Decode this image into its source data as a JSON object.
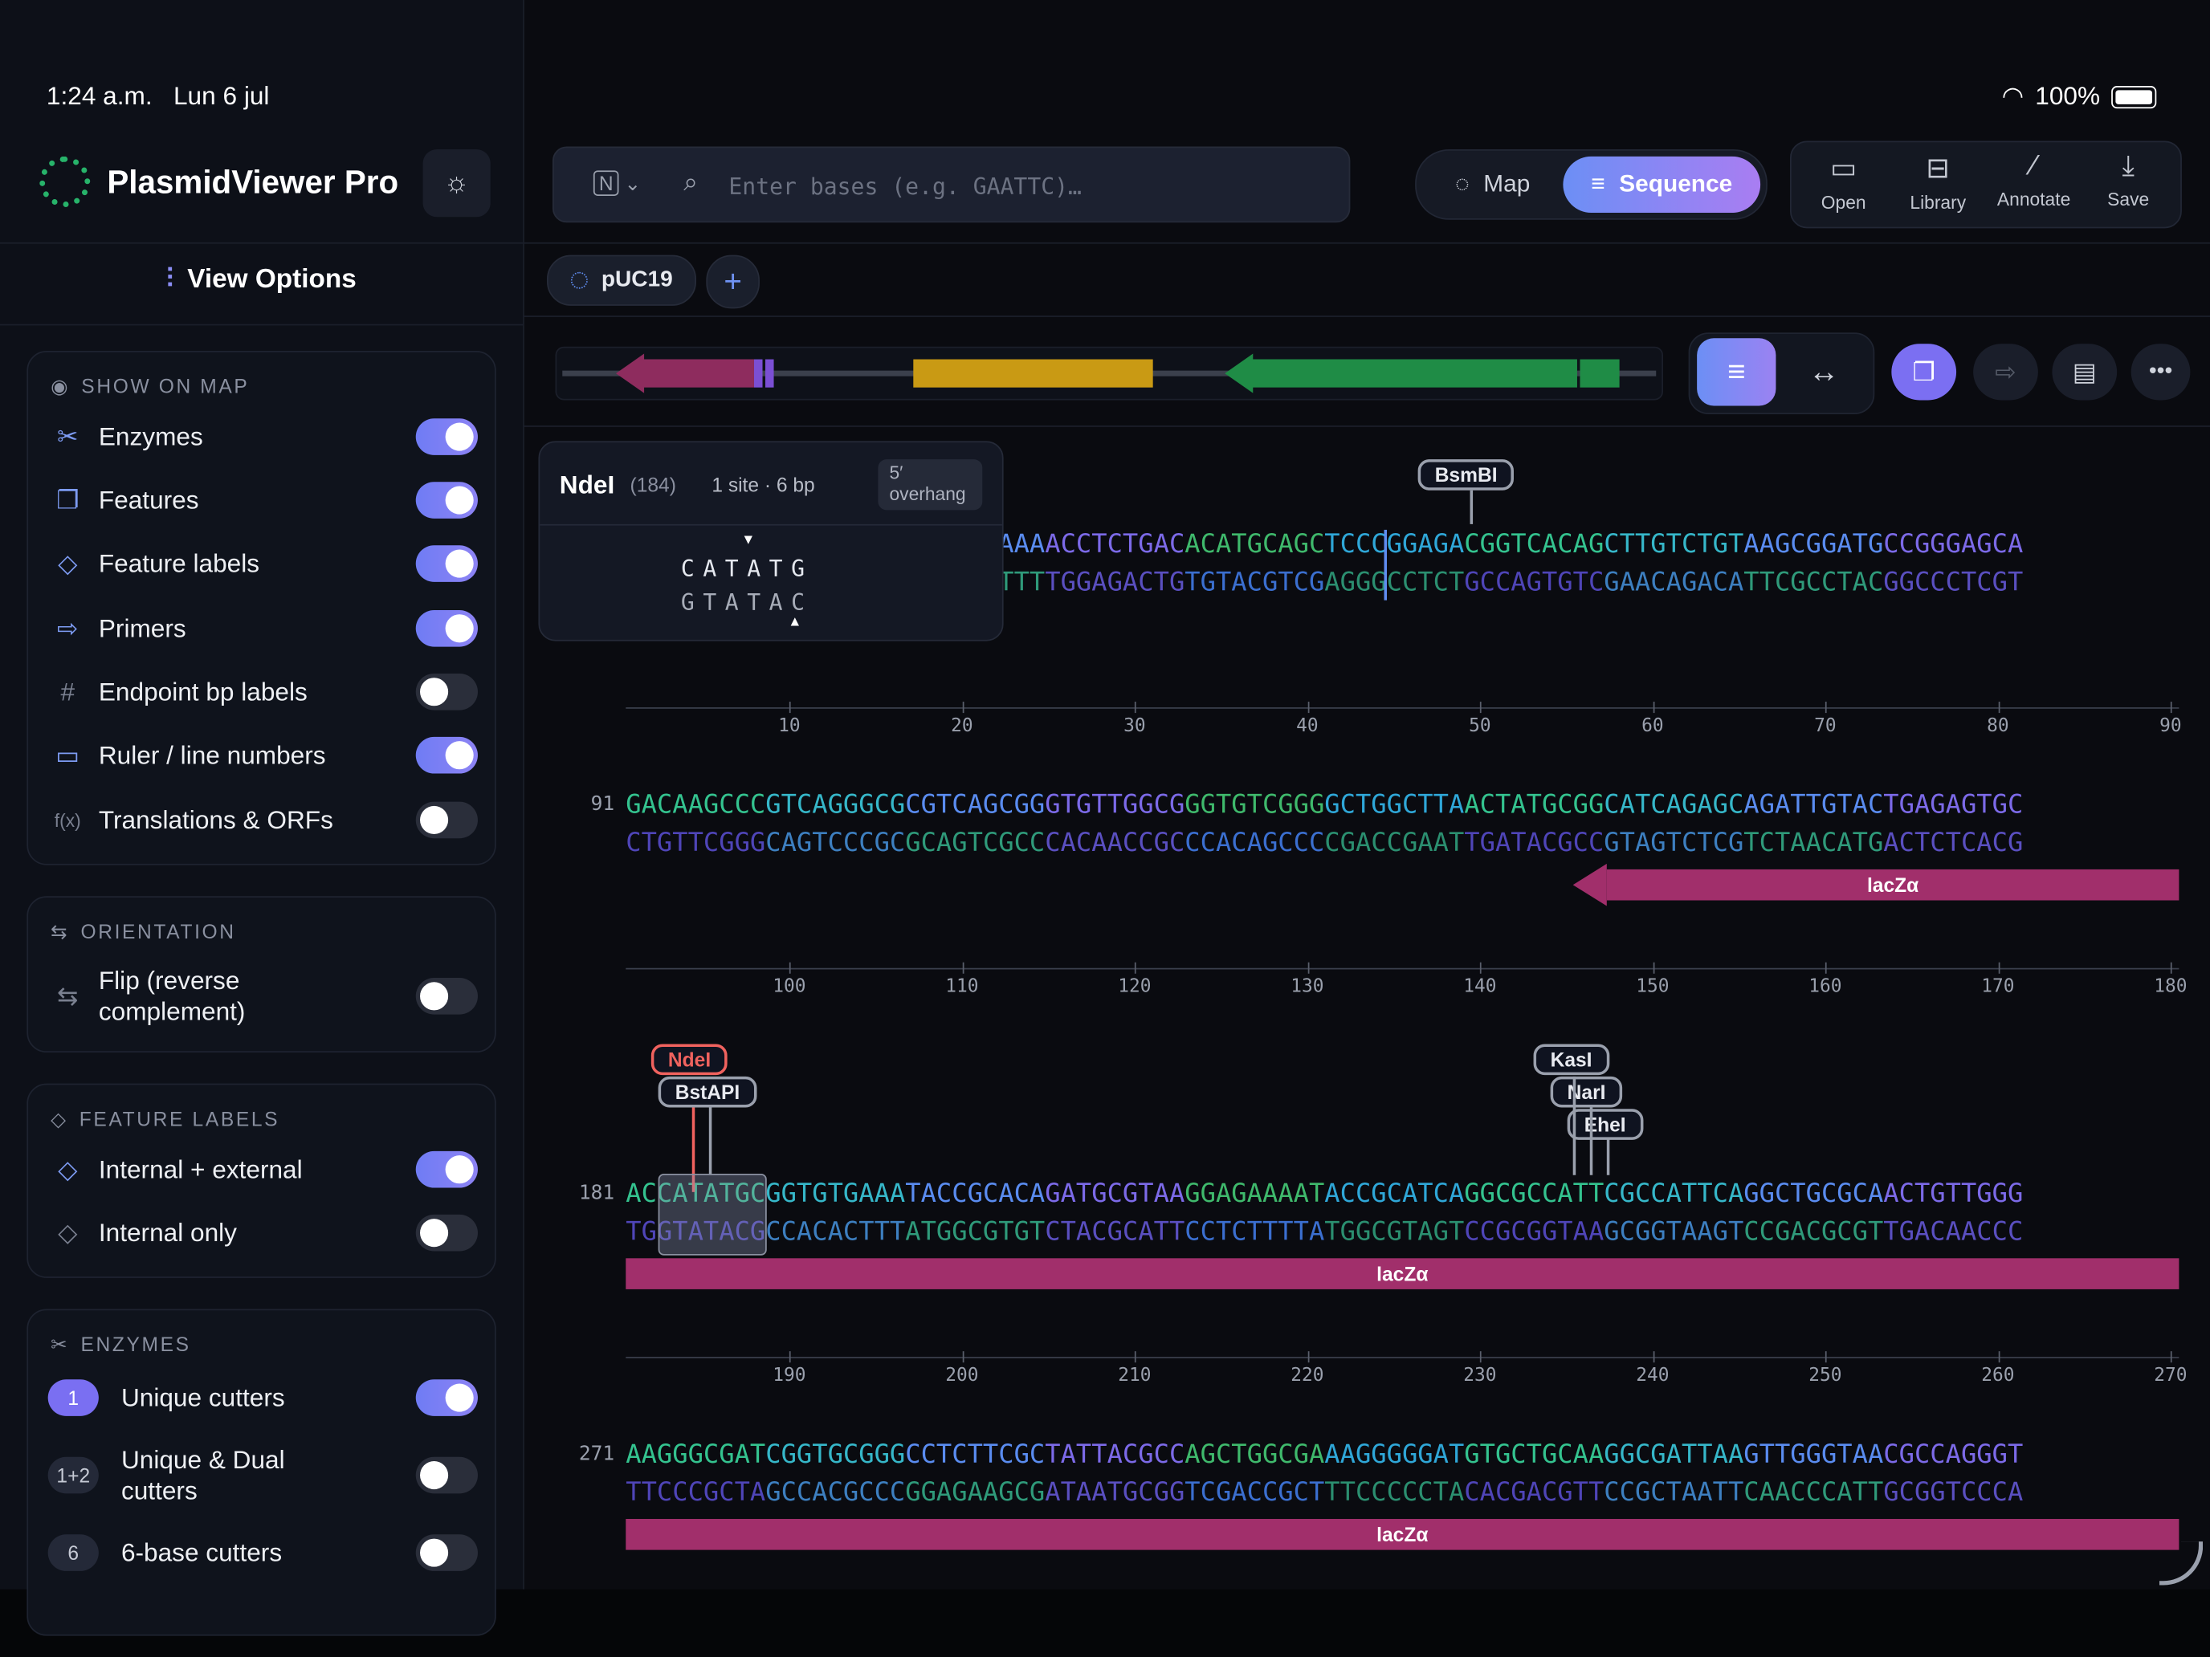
{
  "status": {
    "time": "1:24 a.m.",
    "date": "Lun 6 jul",
    "battery": "100%"
  },
  "app": {
    "title": "PlasmidViewer Pro"
  },
  "sidebar": {
    "view_options": "View Options",
    "show_on_map": {
      "header": "SHOW ON MAP",
      "items": [
        {
          "label": "Enzymes",
          "on": true,
          "icon": "scissors-icon"
        },
        {
          "label": "Features",
          "on": true,
          "icon": "layers-icon"
        },
        {
          "label": "Feature labels",
          "on": true,
          "icon": "tag-icon"
        },
        {
          "label": "Primers",
          "on": true,
          "icon": "arrow-right-icon"
        },
        {
          "label": "Endpoint bp labels",
          "on": false,
          "icon": "hash-icon"
        },
        {
          "label": "Ruler / line numbers",
          "on": true,
          "icon": "ruler-icon"
        },
        {
          "label": "Translations & ORFs",
          "on": false,
          "icon": "function-icon"
        }
      ]
    },
    "orientation": {
      "header": "ORIENTATION",
      "items": [
        {
          "label": "Flip (reverse complement)",
          "on": false
        }
      ]
    },
    "feature_labels": {
      "header": "FEATURE LABELS",
      "items": [
        {
          "label": "Internal + external",
          "on": true
        },
        {
          "label": "Internal only",
          "on": false
        }
      ]
    },
    "enzymes": {
      "header": "ENZYMES",
      "items": [
        {
          "badge": "1",
          "label": "Unique cutters",
          "on": true
        },
        {
          "badge": "1+2",
          "label": "Unique & Dual cutters",
          "on": false
        },
        {
          "badge": "6",
          "label": "6-base cutters",
          "on": false
        }
      ]
    }
  },
  "search": {
    "mode": "N",
    "placeholder": "Enter bases (e.g. GAATTC)…"
  },
  "view_toggle": {
    "map": "Map",
    "sequence": "Sequence",
    "active": "Sequence"
  },
  "toolbar": {
    "open": "Open",
    "library": "Library",
    "annotate": "Annotate",
    "save": "Save"
  },
  "tabs": [
    {
      "label": "pUC19"
    }
  ],
  "popover": {
    "enzyme": "NdeI",
    "position": "(184)",
    "info": "1 site · 6 bp",
    "overhang_line1": "5′",
    "overhang_line2": "overhang",
    "top": "CATATG",
    "bottom": "GTATAC"
  },
  "sequence": {
    "rows": [
      {
        "start": "",
        "top": "TCGCGCGTTTCGGTGATGACGGTGAAAACCTCTGACACATGCAGCTCCCGGAGACGGTCACAGCTTGTCTGTAAGCGGATGCCGGGAGCA",
        "bottom": "AGCGCGCAAAGCCACTACTGCCACTTTTGGAGACTGTGTACGTCGAGGGCCTCTGCCAGTGTCGAACAGACATTCGCCTACGGCCCTCGT",
        "ticks": [
          "10",
          "20",
          "30",
          "40",
          "50",
          "60",
          "70",
          "80",
          "90"
        ],
        "enzymes": [
          "BsmBI"
        ]
      },
      {
        "start": "91",
        "top": "GACAAGCCCGTCAGGGCGCGTCAGCGGGTGTTGGCGGGTGTCGGGGCTGGCTTAACTATGCGGCATCAGAGCAGATTGTACTGAGAGTGC",
        "bottom": "CTGTTCGGGCAGTCCCGCGCAGTCGCCCACAACCGCCCACAGCCCCGACCGAATTGATACGCCGTAGTCTCGTCTAACATGACTCTCACG",
        "ticks": [
          "100",
          "110",
          "120",
          "130",
          "140",
          "150",
          "160",
          "170",
          "180"
        ],
        "feature": "lacZα"
      },
      {
        "start": "181",
        "top": "ACCATATGCGGTGTGAAATACCGCACAGATGCGTAAGGAGAAAATACCGCATCAGGCGCCATTCGCCATTCAGGCTGCGCAACTGTTGGG",
        "bottom": "TGGTATACGCCACACTTTATGGCGTGTCTACGCATTCCTCTTTTATGGCGTAGTCCGCGGTAAGCGGTAAGTCCGACGCGTTGACAACCC",
        "ticks": [
          "190",
          "200",
          "210",
          "220",
          "230",
          "240",
          "250",
          "260",
          "270"
        ],
        "feature": "lacZα",
        "enzymes": [
          "NdeI",
          "BstAPI",
          "KasI",
          "NarI",
          "EheI"
        ]
      },
      {
        "start": "271",
        "top": "AAGGGCGATCGGTGCGGGCCTCTTCGCTATTACGCCAGCTGGCGAAAGGGGGATGTGCTGCAAGGCGATTAAGTTGGGTAACGCCAGGGT",
        "bottom": "TTCCCGCTAGCCACGCCCGGAGAAGCGATAATGCGGTCGACCGCTTTCCCCCTACACGACGTTCCGCTAATTCAACCCATTGCGGTCCCA",
        "feature": "lacZα"
      }
    ]
  },
  "colors": {
    "feature": "#a12f6b",
    "accent": "#7a6ff2",
    "selected_enzyme": "#f0625e"
  }
}
